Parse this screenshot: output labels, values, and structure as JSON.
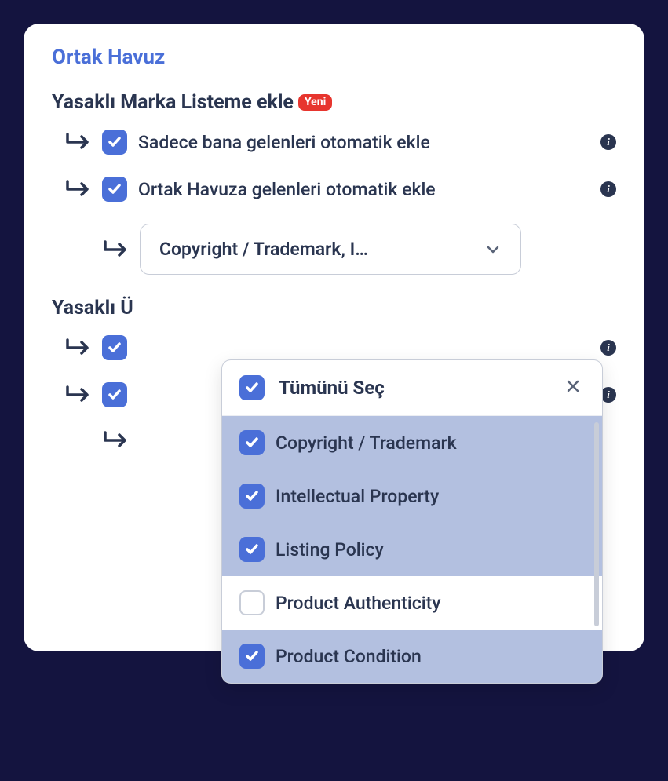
{
  "section_title": "Ortak Havuz",
  "brand_block": {
    "title": "Yasaklı Marka Listeme ekle",
    "badge": "Yeni",
    "option1": {
      "label": "Sadece bana gelenleri otomatik ekle",
      "checked": true
    },
    "option2": {
      "label": "Ortak Havuza gelenleri otomatik ekle",
      "checked": true
    },
    "select_value": "Copyright / Trademark, I…"
  },
  "product_block": {
    "title_visible": "Yasaklı Ü",
    "option1": {
      "checked": true
    },
    "option2": {
      "checked": true
    }
  },
  "dropdown": {
    "select_all": "Tümünü Seç",
    "items": [
      {
        "label": "Copyright / Trademark",
        "checked": true,
        "selected": true
      },
      {
        "label": "Intellectual Property",
        "checked": true,
        "selected": true
      },
      {
        "label": "Listing Policy",
        "checked": true,
        "selected": true
      },
      {
        "label": "Product Authenticity",
        "checked": false,
        "selected": false
      },
      {
        "label": "Product Condition",
        "checked": true,
        "selected": true
      }
    ]
  }
}
